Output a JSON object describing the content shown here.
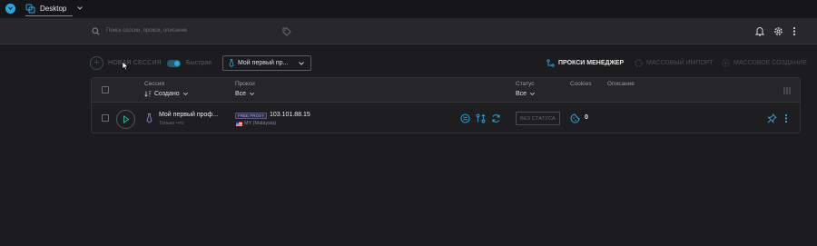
{
  "app": {
    "workspace_name": "Desktop"
  },
  "search": {
    "placeholder": "Поиск сессии, прокси, описание"
  },
  "toolbar": {
    "new_session_label": "НОВАЯ СЕССИЯ",
    "quick_label": "Быстрая",
    "quick_enabled": true,
    "profile_selected": "Мой первый пр...",
    "proxy_manager_label": "ПРОКСИ МЕНЕДЖЕР",
    "mass_import_label": "МАССОВЫЙ ИМПОРТ",
    "mass_create_label": "МАССОВОЕ СОЗДАНИЕ"
  },
  "table": {
    "columns": {
      "session": {
        "title": "Сессия",
        "filter": "Создано"
      },
      "proxy": {
        "title": "Прокси",
        "filter": "Все"
      },
      "status": {
        "title": "Статус",
        "filter": "Все"
      },
      "cookies": {
        "title": "Cookies"
      },
      "description": {
        "title": "Описание"
      }
    },
    "rows": [
      {
        "name": "Мой первый проф...",
        "created": "Только что",
        "proxy_tag": "FREE PROXY",
        "proxy_ip": "103.101.88.15",
        "proxy_location": "MY (Malaysia)",
        "status": "БЕЗ СТАТУСА",
        "cookies": "0"
      }
    ]
  },
  "colors": {
    "accent": "#29a8e0",
    "background": "#1c1c1e",
    "header": "#28282a"
  }
}
